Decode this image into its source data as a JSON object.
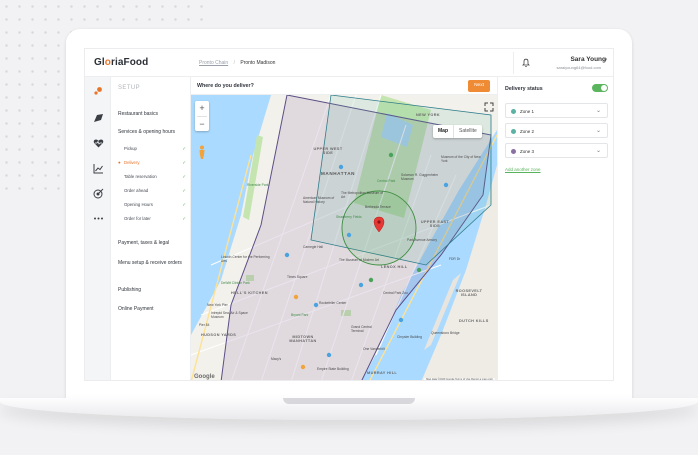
{
  "brand": {
    "logo_text_1": "Gl",
    "logo_o": "o",
    "logo_text_2": "riaFood",
    "accent": "#e8752a"
  },
  "breadcrumb": {
    "parent": "Pronto Chain",
    "current": "Pronto Madison"
  },
  "user": {
    "name": "Sara Young",
    "email": "saraiyoung64@food.com"
  },
  "icons": {
    "notifications": "bell-icon",
    "rail": [
      "setup-icon",
      "delivery-icon",
      "heart-monitor-icon",
      "chart-icon",
      "target-icon",
      "more-icon"
    ]
  },
  "nav": {
    "setup_label": "SETUP",
    "restaurant_basics": "Restaurant basics",
    "services_hours": "Services & opening hours",
    "sub_items": [
      {
        "label": "Pickup",
        "checked": true,
        "active": false
      },
      {
        "label": "Delivery",
        "checked": true,
        "active": true
      },
      {
        "label": "Table reservation",
        "checked": true,
        "active": false
      },
      {
        "label": "Order ahead",
        "checked": true,
        "active": false
      },
      {
        "label": "Opening Hours",
        "checked": true,
        "active": false
      },
      {
        "label": "Order for later",
        "checked": true,
        "active": false
      }
    ],
    "payment": "Payment, taxes & legal",
    "menu_setup": "Menu setup & receive orders",
    "publishing": "Publishing",
    "online_payment": "Online Payment"
  },
  "map_panel": {
    "question": "Where do you deliver?",
    "next_button": "Next",
    "map_type_map": "Map",
    "map_type_satellite": "Satellite",
    "zoom_in": "+",
    "zoom_out": "−",
    "google": "Google",
    "attribution": "Map data ©2020 Google   Terms of Use   Report a map error",
    "labels": {
      "manhattan": "MANHATTAN",
      "upper_west_side": "UPPER WEST SIDE",
      "upper_east_side": "UPPER EAST SIDE",
      "hells_kitchen": "HELL'S KITCHEN",
      "midtown": "MIDTOWN MANHATTAN",
      "murray_hill": "MURRAY HILL",
      "hudson_yards": "HUDSON YARDS",
      "lenox_hill": "LENOX HILL",
      "roosevelt_island": "ROOSEVELT ISLAND",
      "dutch_kills": "DUTCH KILLS",
      "central_park": "Central Park",
      "metropolitan_museum": "The Metropolitan Museum of Art",
      "amnh": "American Museum of Natural History",
      "guggenheim": "Solomon R. Guggenheim Museum",
      "new_york": "NEW YORK",
      "lincoln_center": "Lincoln Center for the Performing Arts",
      "times_square": "Times Square",
      "moma": "The Museum of Modern Art",
      "rockefeller": "Rockefeller Center",
      "bryant_park": "Bryant Park",
      "grand_central": "Grand Central Terminal",
      "empire_state": "Empire State Building",
      "macys": "Macy's",
      "park_ave_armory": "Park Avenue Armory",
      "queensboro_bridge": "Queensboro Bridge",
      "fdr": "FDR Dr",
      "intrepid": "Intrepid Sea, Air & Space Museum",
      "one_vanderbilt": "One Vanderbilt",
      "chrysler": "Chrysler Building",
      "pier_84": "Pier 84",
      "museum_city": "Museum of the City of New York",
      "central_park_zoo": "Central Park Zoo",
      "strawberry_fields": "Strawberry Fields",
      "carnegie_hall": "Carnegie Hall",
      "ny_pier": "New York Pier",
      "dewitt_clinton": "DeWitt Clinton Park",
      "riverside_park": "Riverside Park",
      "bethesda_terrace": "Bethesda Terrace"
    }
  },
  "delivery": {
    "status_label": "Delivery status",
    "enabled": true,
    "zones": [
      {
        "name": "Zone 1",
        "color": "#5bb2a4"
      },
      {
        "name": "Zone 2",
        "color": "#5bb2a4"
      },
      {
        "name": "Zone 3",
        "color": "#8a6fa3"
      }
    ],
    "add_zone": "Add another zone"
  }
}
